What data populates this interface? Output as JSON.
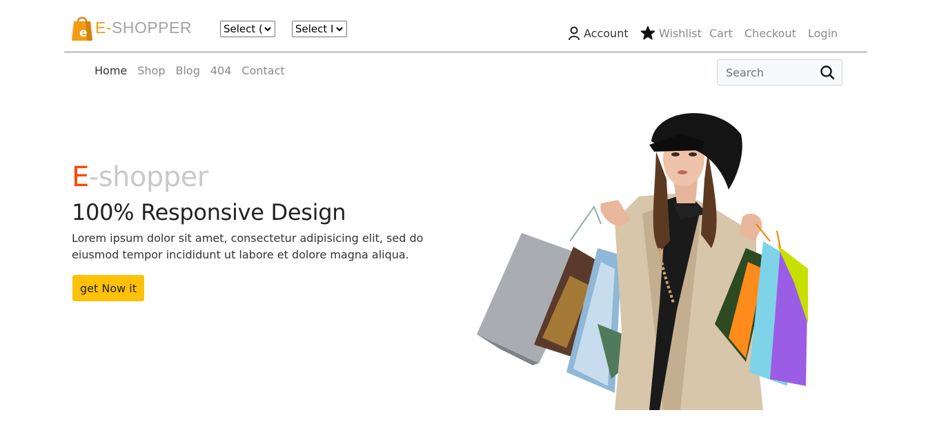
{
  "logo": {
    "letter": "e",
    "prefix": "E-",
    "rest": "SHOPPER"
  },
  "selects": [
    {
      "value": "Select ("
    },
    {
      "value": "Select I"
    }
  ],
  "top_menu": [
    {
      "label": "Account",
      "icon": "user-icon"
    },
    {
      "label": "Wishlist",
      "icon": "star-icon"
    },
    {
      "label": "Cart"
    },
    {
      "label": "Checkout"
    },
    {
      "label": "Login"
    }
  ],
  "nav": [
    {
      "label": "Home",
      "active": true
    },
    {
      "label": "Shop"
    },
    {
      "label": "Blog"
    },
    {
      "label": "404"
    },
    {
      "label": "Contact"
    }
  ],
  "search": {
    "placeholder": "Search",
    "icon": "search-icon"
  },
  "hero": {
    "brand_first": "E",
    "brand_rest": "-shopper",
    "headline": "100% Responsive Design",
    "description": "Lorem ipsum dolor sit amet, consectetur adipisicing elit, sed do eiusmod tempor incididunt ut labore et dolore magna aliqua.",
    "cta_label": "get Now it"
  },
  "colors": {
    "brand_orange": "#f39c12",
    "hero_accent": "#fe4600",
    "cta_yellow": "#fec107"
  }
}
